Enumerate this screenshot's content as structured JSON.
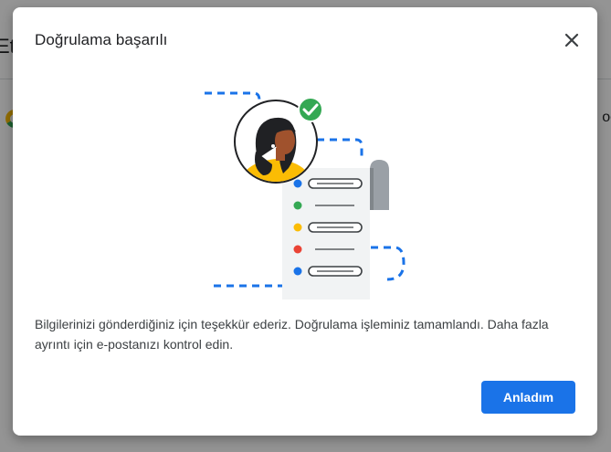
{
  "background": {
    "title_fragment": "Et",
    "right_text_fragment": "oo",
    "logo_icon": "google-logo-icon"
  },
  "dialog": {
    "title": "Doğrulama başarılı",
    "close_icon": "close-icon",
    "illustration_icon": "verified-user-checklist-illustration",
    "message": "Bilgilerinizi gönderdiğiniz için teşekkür ederiz. Doğrulama işleminiz tamamlandı. Daha fazla ayrıntı için e-postanızı kontrol edin.",
    "button_label": "Anladım"
  },
  "colors": {
    "accent_blue": "#1a73e8",
    "check_green": "#34a853",
    "dot_yellow": "#fbbc04",
    "dot_red": "#ea4335",
    "scrim": "rgba(0,0,0,0.42)"
  }
}
